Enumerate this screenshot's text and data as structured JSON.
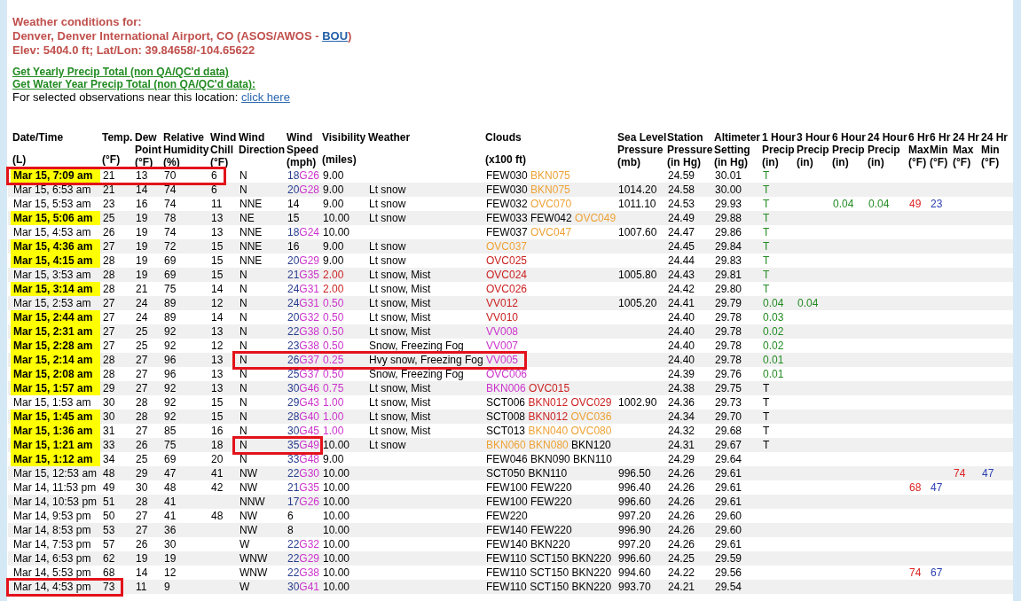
{
  "station": {
    "heading": "Weather conditions for:",
    "name": "Denver, Denver International Airport, CO (ASOS/AWOS -",
    "code": "BOU",
    "name_end": ")",
    "location": "Elev: 5404.0 ft; Lat/Lon: 39.84658/-104.65622"
  },
  "precip_links": [
    "Get Yearly Precip Total (non QA/QC'd data)",
    "Get Water Year Precip Total (non QA/QC'd data):"
  ],
  "nearby": {
    "text": "For selected observations near this location:",
    "link": "click here"
  },
  "columns": [
    {
      "kind": "time",
      "title": [
        "Date/Time"
      ],
      "unit": "(L)"
    },
    {
      "kind": "text",
      "title": [
        "Temp."
      ],
      "unit": "(°F)"
    },
    {
      "kind": "text",
      "title": [
        "Dew",
        "Point"
      ],
      "unit": "(°F)"
    },
    {
      "kind": "text",
      "title": [
        "Relative",
        "Humidity"
      ],
      "unit": "(%)"
    },
    {
      "kind": "text",
      "title": [
        "Wind",
        "Chill"
      ],
      "unit": "(°F)"
    },
    {
      "kind": "text",
      "title": [
        "Wind",
        "Direction"
      ]
    },
    {
      "kind": "gusts",
      "title": [
        "Wind",
        "Speed"
      ],
      "unit": "(mph)"
    },
    {
      "kind": "text",
      "title": [
        "Visibility"
      ],
      "unit": "(miles)"
    },
    {
      "kind": "text",
      "title": [
        "Weather"
      ]
    },
    {
      "kind": "layers",
      "title": [
        "Clouds"
      ],
      "unit": "(x100 ft)"
    },
    {
      "kind": "text",
      "title": [
        "Sea Level",
        "Pressure"
      ],
      "unit": "(mb)"
    },
    {
      "kind": "text",
      "title": [
        "Station",
        "Pressure"
      ],
      "unit": "(in Hg)"
    },
    {
      "kind": "text",
      "title": [
        "Altimeter",
        "Setting"
      ],
      "unit": "(in Hg)"
    },
    {
      "kind": "text",
      "title": [
        "1 Hour",
        "Precip"
      ],
      "unit": "(in)"
    },
    {
      "kind": "text",
      "title": [
        "3 Hour",
        "Precip"
      ],
      "unit": "(in)"
    },
    {
      "kind": "text",
      "title": [
        "6 Hour",
        "Precip"
      ],
      "unit": "(in)"
    },
    {
      "kind": "text",
      "title": [
        "24 Hour",
        "Precip"
      ],
      "unit": "(in)"
    },
    {
      "kind": "text",
      "title": [
        "6 Hr",
        "Max"
      ],
      "unit": "(°F)"
    },
    {
      "kind": "text",
      "title": [
        "6 Hr",
        "Min"
      ],
      "unit": "(°F)"
    },
    {
      "kind": "text",
      "title": [
        "24 Hr",
        "Max"
      ],
      "unit": "(°F)"
    },
    {
      "kind": "text",
      "title": [
        "24 Hr",
        "Min"
      ],
      "unit": "(°F)"
    }
  ],
  "rows": [
    {
      "time": "Mar 15, 7:09 am",
      "highlighted": true,
      "temp": "21",
      "dew_point": "13",
      "humidity": "70",
      "wind_chill": "6",
      "wind_direction": "N",
      "wind_speed": [
        {
          "text": "18",
          "color": "#283c8c"
        },
        {
          "text": "G26",
          "color": "#cc33cc"
        }
      ],
      "visibility": {
        "text": "9.00",
        "color": "#000000"
      },
      "clouds": [
        {
          "text": "FEW030",
          "color": "#000000"
        },
        {
          "text": "BKN075",
          "color": "#eea236"
        }
      ],
      "station_pressure": "24.59",
      "altimeter": "30.01",
      "precip_1h": {
        "text": "T",
        "color": "#228b22"
      },
      "outlined": {
        "time": true,
        "temp": true,
        "dew_point": true,
        "humidity": true,
        "wind_chill": true
      }
    },
    {
      "time": "Mar 15, 6:53 am",
      "highlighted": false,
      "temp": "21",
      "dew_point": "14",
      "humidity": "74",
      "wind_chill": "6",
      "wind_direction": "N",
      "wind_speed": [
        {
          "text": "20",
          "color": "#283c8c"
        },
        {
          "text": "G28",
          "color": "#cc33cc"
        }
      ],
      "visibility": {
        "text": "9.00",
        "color": "#000000"
      },
      "weather": "Lt snow",
      "clouds": [
        {
          "text": "FEW030",
          "color": "#000000"
        },
        {
          "text": "BKN075",
          "color": "#eea236"
        }
      ],
      "sea_level_pressure": "1014.20",
      "station_pressure": "24.58",
      "altimeter": "30.00",
      "precip_1h": {
        "text": "T",
        "color": "#228b22"
      }
    },
    {
      "time": "Mar 15, 5:53 am",
      "highlighted": false,
      "temp": "23",
      "dew_point": "16",
      "humidity": "74",
      "wind_chill": "11",
      "wind_direction": "NNE",
      "wind_speed": [
        {
          "text": "14",
          "color": "#000000"
        }
      ],
      "visibility": {
        "text": "9.00",
        "color": "#000000"
      },
      "weather": "Lt snow",
      "clouds": [
        {
          "text": "FEW032",
          "color": "#000000"
        },
        {
          "text": "OVC070",
          "color": "#eea236"
        }
      ],
      "sea_level_pressure": "1011.10",
      "station_pressure": "24.53",
      "altimeter": "29.93",
      "precip_1h": {
        "text": "T",
        "color": "#228b22"
      },
      "precip_6h": {
        "text": "0.04",
        "color": "#228b22"
      },
      "precip_24h": {
        "text": "0.04",
        "color": "#228b22"
      },
      "max_6h": {
        "text": "49",
        "color": "#dd2222"
      },
      "min_6h": {
        "text": "23",
        "color": "#2a3fb0"
      }
    },
    {
      "time": "Mar 15, 5:06 am",
      "highlighted": true,
      "temp": "25",
      "dew_point": "19",
      "humidity": "78",
      "wind_chill": "13",
      "wind_direction": "NE",
      "wind_speed": [
        {
          "text": "15",
          "color": "#000000"
        }
      ],
      "visibility": {
        "text": "10.00",
        "color": "#000000"
      },
      "weather": "Lt snow",
      "clouds": [
        {
          "text": "FEW033",
          "color": "#000000"
        },
        {
          "text": "FEW042",
          "color": "#000000"
        },
        {
          "text": "OVC049",
          "color": "#eea236"
        }
      ],
      "station_pressure": "24.49",
      "altimeter": "29.88",
      "precip_1h": {
        "text": "T",
        "color": "#228b22"
      }
    },
    {
      "time": "Mar 15, 4:53 am",
      "highlighted": false,
      "temp": "26",
      "dew_point": "19",
      "humidity": "74",
      "wind_chill": "13",
      "wind_direction": "NNE",
      "wind_speed": [
        {
          "text": "18",
          "color": "#283c8c"
        },
        {
          "text": "G24",
          "color": "#cc33cc"
        }
      ],
      "visibility": {
        "text": "10.00",
        "color": "#000000"
      },
      "clouds": [
        {
          "text": "FEW037",
          "color": "#000000"
        },
        {
          "text": "OVC047",
          "color": "#eea236"
        }
      ],
      "sea_level_pressure": "1007.60",
      "station_pressure": "24.47",
      "altimeter": "29.86",
      "precip_1h": {
        "text": "T",
        "color": "#228b22"
      }
    },
    {
      "time": "Mar 15, 4:36 am",
      "highlighted": true,
      "temp": "27",
      "dew_point": "19",
      "humidity": "72",
      "wind_chill": "15",
      "wind_direction": "NNE",
      "wind_speed": [
        {
          "text": "16",
          "color": "#000000"
        }
      ],
      "visibility": {
        "text": "9.00",
        "color": "#000000"
      },
      "weather": "Lt snow",
      "clouds": [
        {
          "text": "OVC037",
          "color": "#eea236"
        }
      ],
      "station_pressure": "24.45",
      "altimeter": "29.84",
      "precip_1h": {
        "text": "T",
        "color": "#228b22"
      }
    },
    {
      "time": "Mar 15, 4:15 am",
      "highlighted": true,
      "temp": "28",
      "dew_point": "19",
      "humidity": "69",
      "wind_chill": "15",
      "wind_direction": "NNE",
      "wind_speed": [
        {
          "text": "20",
          "color": "#283c8c"
        },
        {
          "text": "G29",
          "color": "#cc33cc"
        }
      ],
      "visibility": {
        "text": "9.00",
        "color": "#000000"
      },
      "weather": "Lt snow",
      "clouds": [
        {
          "text": "OVC025",
          "color": "#cc2222"
        }
      ],
      "station_pressure": "24.44",
      "altimeter": "29.83",
      "precip_1h": {
        "text": "T",
        "color": "#228b22"
      }
    },
    {
      "time": "Mar 15, 3:53 am",
      "highlighted": false,
      "temp": "28",
      "dew_point": "19",
      "humidity": "69",
      "wind_chill": "15",
      "wind_direction": "N",
      "wind_speed": [
        {
          "text": "21",
          "color": "#283c8c"
        },
        {
          "text": "G35",
          "color": "#cc33cc"
        }
      ],
      "visibility": {
        "text": "2.00",
        "color": "#cc2222"
      },
      "weather": "Lt snow, Mist",
      "clouds": [
        {
          "text": "OVC024",
          "color": "#cc2222"
        }
      ],
      "sea_level_pressure": "1005.80",
      "station_pressure": "24.43",
      "altimeter": "29.81",
      "precip_1h": {
        "text": "T",
        "color": "#228b22"
      }
    },
    {
      "time": "Mar 15, 3:14 am",
      "highlighted": true,
      "temp": "28",
      "dew_point": "21",
      "humidity": "75",
      "wind_chill": "14",
      "wind_direction": "N",
      "wind_speed": [
        {
          "text": "24",
          "color": "#283c8c"
        },
        {
          "text": "G31",
          "color": "#cc33cc"
        }
      ],
      "visibility": {
        "text": "2.00",
        "color": "#cc2222"
      },
      "weather": "Lt snow, Mist",
      "clouds": [
        {
          "text": "OVC026",
          "color": "#cc2222"
        }
      ],
      "station_pressure": "24.42",
      "altimeter": "29.80",
      "precip_1h": {
        "text": "T",
        "color": "#228b22"
      }
    },
    {
      "time": "Mar 15, 2:53 am",
      "highlighted": false,
      "temp": "27",
      "dew_point": "24",
      "humidity": "89",
      "wind_chill": "12",
      "wind_direction": "N",
      "wind_speed": [
        {
          "text": "24",
          "color": "#283c8c"
        },
        {
          "text": "G31",
          "color": "#cc33cc"
        }
      ],
      "visibility": {
        "text": "0.50",
        "color": "#cc33cc"
      },
      "weather": "Lt snow, Mist",
      "clouds": [
        {
          "text": "VV012",
          "color": "#cc2222"
        }
      ],
      "sea_level_pressure": "1005.20",
      "station_pressure": "24.41",
      "altimeter": "29.79",
      "precip_1h": {
        "text": "0.04",
        "color": "#228b22"
      },
      "precip_3h": {
        "text": "0.04",
        "color": "#228b22"
      }
    },
    {
      "time": "Mar 15, 2:44 am",
      "highlighted": true,
      "temp": "27",
      "dew_point": "24",
      "humidity": "89",
      "wind_chill": "14",
      "wind_direction": "N",
      "wind_speed": [
        {
          "text": "20",
          "color": "#283c8c"
        },
        {
          "text": "G32",
          "color": "#cc33cc"
        }
      ],
      "visibility": {
        "text": "0.50",
        "color": "#cc33cc"
      },
      "weather": "Lt snow, Mist",
      "clouds": [
        {
          "text": "VV010",
          "color": "#cc2222"
        }
      ],
      "station_pressure": "24.40",
      "altimeter": "29.78",
      "precip_1h": {
        "text": "0.03",
        "color": "#228b22"
      }
    },
    {
      "time": "Mar 15, 2:31 am",
      "highlighted": true,
      "temp": "27",
      "dew_point": "25",
      "humidity": "92",
      "wind_chill": "13",
      "wind_direction": "N",
      "wind_speed": [
        {
          "text": "22",
          "color": "#283c8c"
        },
        {
          "text": "G38",
          "color": "#cc33cc"
        }
      ],
      "visibility": {
        "text": "0.50",
        "color": "#cc33cc"
      },
      "weather": "Lt snow, Mist",
      "clouds": [
        {
          "text": "VV008",
          "color": "#cc33cc"
        }
      ],
      "station_pressure": "24.40",
      "altimeter": "29.78",
      "precip_1h": {
        "text": "0.02",
        "color": "#228b22"
      }
    },
    {
      "time": "Mar 15, 2:28 am",
      "highlighted": true,
      "temp": "27",
      "dew_point": "25",
      "humidity": "92",
      "wind_chill": "12",
      "wind_direction": "N",
      "wind_speed": [
        {
          "text": "23",
          "color": "#283c8c"
        },
        {
          "text": "G38",
          "color": "#cc33cc"
        }
      ],
      "visibility": {
        "text": "0.50",
        "color": "#cc33cc"
      },
      "weather": "Snow, Freezing Fog",
      "clouds": [
        {
          "text": "VV007",
          "color": "#cc33cc"
        }
      ],
      "station_pressure": "24.40",
      "altimeter": "29.78",
      "precip_1h": {
        "text": "0.02",
        "color": "#228b22"
      }
    },
    {
      "time": "Mar 15, 2:14 am",
      "highlighted": true,
      "temp": "28",
      "dew_point": "27",
      "humidity": "96",
      "wind_chill": "13",
      "wind_direction": "N",
      "wind_speed": [
        {
          "text": "26",
          "color": "#283c8c"
        },
        {
          "text": "G37",
          "color": "#cc33cc"
        }
      ],
      "visibility": {
        "text": "0.25",
        "color": "#cc33cc"
      },
      "weather": "Hvy snow, Freezing Fog",
      "clouds": [
        {
          "text": "VV005",
          "color": "#cc33cc"
        }
      ],
      "station_pressure": "24.40",
      "altimeter": "29.78",
      "precip_1h": {
        "text": "0.01",
        "color": "#228b22"
      },
      "outlined": {
        "wind_direction": true,
        "wind_speed": true,
        "visibility": true,
        "weather": true,
        "clouds": true
      }
    },
    {
      "time": "Mar 15, 2:08 am",
      "highlighted": true,
      "temp": "28",
      "dew_point": "27",
      "humidity": "96",
      "wind_chill": "13",
      "wind_direction": "N",
      "wind_speed": [
        {
          "text": "25",
          "color": "#283c8c"
        },
        {
          "text": "G37",
          "color": "#cc33cc"
        }
      ],
      "visibility": {
        "text": "0.50",
        "color": "#cc33cc"
      },
      "weather": "Snow, Freezing Fog",
      "clouds": [
        {
          "text": "OVC006",
          "color": "#cc33cc"
        }
      ],
      "station_pressure": "24.39",
      "altimeter": "29.76",
      "precip_1h": {
        "text": "0.01",
        "color": "#228b22"
      }
    },
    {
      "time": "Mar 15, 1:57 am",
      "highlighted": true,
      "temp": "29",
      "dew_point": "27",
      "humidity": "92",
      "wind_chill": "13",
      "wind_direction": "N",
      "wind_speed": [
        {
          "text": "30",
          "color": "#283c8c"
        },
        {
          "text": "G46",
          "color": "#cc33cc"
        }
      ],
      "visibility": {
        "text": "0.75",
        "color": "#cc33cc"
      },
      "weather": "Lt snow, Mist",
      "clouds": [
        {
          "text": "BKN006",
          "color": "#cc33cc"
        },
        {
          "text": "OVC015",
          "color": "#cc2222"
        }
      ],
      "station_pressure": "24.38",
      "altimeter": "29.75",
      "precip_1h": {
        "text": "T",
        "color": "#000000"
      }
    },
    {
      "time": "Mar 15, 1:53 am",
      "highlighted": false,
      "temp": "30",
      "dew_point": "28",
      "humidity": "92",
      "wind_chill": "15",
      "wind_direction": "N",
      "wind_speed": [
        {
          "text": "29",
          "color": "#283c8c"
        },
        {
          "text": "G43",
          "color": "#cc33cc"
        }
      ],
      "visibility": {
        "text": "1.00",
        "color": "#cc33cc"
      },
      "weather": "Lt snow, Mist",
      "clouds": [
        {
          "text": "SCT006",
          "color": "#000000"
        },
        {
          "text": "BKN012",
          "color": "#cc2222"
        },
        {
          "text": "OVC029",
          "color": "#cc2222"
        }
      ],
      "sea_level_pressure": "1002.90",
      "station_pressure": "24.36",
      "altimeter": "29.73",
      "precip_1h": {
        "text": "T",
        "color": "#000000"
      }
    },
    {
      "time": "Mar 15, 1:45 am",
      "highlighted": true,
      "temp": "30",
      "dew_point": "28",
      "humidity": "92",
      "wind_chill": "15",
      "wind_direction": "N",
      "wind_speed": [
        {
          "text": "28",
          "color": "#283c8c"
        },
        {
          "text": "G40",
          "color": "#cc33cc"
        }
      ],
      "visibility": {
        "text": "1.00",
        "color": "#cc33cc"
      },
      "weather": "Lt snow, Mist",
      "clouds": [
        {
          "text": "SCT008",
          "color": "#000000"
        },
        {
          "text": "BKN012",
          "color": "#cc2222"
        },
        {
          "text": "OVC036",
          "color": "#eea236"
        }
      ],
      "station_pressure": "24.34",
      "altimeter": "29.70",
      "precip_1h": {
        "text": "T",
        "color": "#000000"
      }
    },
    {
      "time": "Mar 15, 1:36 am",
      "highlighted": true,
      "temp": "31",
      "dew_point": "27",
      "humidity": "85",
      "wind_chill": "16",
      "wind_direction": "N",
      "wind_speed": [
        {
          "text": "30",
          "color": "#283c8c"
        },
        {
          "text": "G45",
          "color": "#cc33cc"
        }
      ],
      "visibility": {
        "text": "1.00",
        "color": "#cc33cc"
      },
      "weather": "Lt snow, Mist",
      "clouds": [
        {
          "text": "SCT013",
          "color": "#000000"
        },
        {
          "text": "BKN040",
          "color": "#eea236"
        },
        {
          "text": "OVC080",
          "color": "#eea236"
        }
      ],
      "station_pressure": "24.32",
      "altimeter": "29.68",
      "precip_1h": {
        "text": "T",
        "color": "#000000"
      }
    },
    {
      "time": "Mar 15, 1:21 am",
      "highlighted": true,
      "temp": "33",
      "dew_point": "26",
      "humidity": "75",
      "wind_chill": "18",
      "wind_direction": "N",
      "wind_speed": [
        {
          "text": "35",
          "color": "#283c8c"
        },
        {
          "text": "G49",
          "color": "#cc33cc"
        }
      ],
      "visibility": {
        "text": "10.00",
        "color": "#000000"
      },
      "weather": "Lt snow",
      "clouds": [
        {
          "text": "BKN060",
          "color": "#eea236"
        },
        {
          "text": "BKN080",
          "color": "#eea236"
        },
        {
          "text": "BKN120",
          "color": "#000000"
        }
      ],
      "station_pressure": "24.31",
      "altimeter": "29.67",
      "precip_1h": {
        "text": "T",
        "color": "#000000"
      },
      "outlined": {
        "wind_direction": true,
        "wind_speed": true
      }
    },
    {
      "time": "Mar 15, 1:12 am",
      "highlighted": true,
      "temp": "34",
      "dew_point": "25",
      "humidity": "69",
      "wind_chill": "20",
      "wind_direction": "N",
      "wind_speed": [
        {
          "text": "33",
          "color": "#283c8c"
        },
        {
          "text": "G48",
          "color": "#cc33cc"
        }
      ],
      "visibility": {
        "text": "9.00",
        "color": "#000000"
      },
      "clouds": [
        {
          "text": "FEW046",
          "color": "#000000"
        },
        {
          "text": "BKN090",
          "color": "#000000"
        },
        {
          "text": "BKN110",
          "color": "#000000"
        }
      ],
      "station_pressure": "24.29",
      "altimeter": "29.64"
    },
    {
      "time": "Mar 15, 12:53 am",
      "highlighted": false,
      "temp": "48",
      "dew_point": "29",
      "humidity": "47",
      "wind_chill": "41",
      "wind_direction": "NW",
      "wind_speed": [
        {
          "text": "22",
          "color": "#283c8c"
        },
        {
          "text": "G30",
          "color": "#cc33cc"
        }
      ],
      "visibility": {
        "text": "10.00",
        "color": "#000000"
      },
      "clouds": [
        {
          "text": "SCT050",
          "color": "#000000"
        },
        {
          "text": "BKN110",
          "color": "#000000"
        }
      ],
      "sea_level_pressure": "996.50",
      "station_pressure": "24.26",
      "altimeter": "29.61",
      "max_24h": {
        "text": "74",
        "color": "#dd2222"
      },
      "min_24h": {
        "text": "47",
        "color": "#2a3fb0"
      }
    },
    {
      "time": "Mar 14, 11:53 pm",
      "highlighted": false,
      "temp": "49",
      "dew_point": "30",
      "humidity": "48",
      "wind_chill": "42",
      "wind_direction": "NW",
      "wind_speed": [
        {
          "text": "21",
          "color": "#283c8c"
        },
        {
          "text": "G35",
          "color": "#cc33cc"
        }
      ],
      "visibility": {
        "text": "10.00",
        "color": "#000000"
      },
      "clouds": [
        {
          "text": "FEW100",
          "color": "#000000"
        },
        {
          "text": "FEW220",
          "color": "#000000"
        }
      ],
      "sea_level_pressure": "996.40",
      "station_pressure": "24.26",
      "altimeter": "29.61",
      "max_6h": {
        "text": "68",
        "color": "#dd2222"
      },
      "min_6h": {
        "text": "47",
        "color": "#2a3fb0"
      }
    },
    {
      "time": "Mar 14, 10:53 pm",
      "highlighted": false,
      "temp": "51",
      "dew_point": "28",
      "humidity": "41",
      "wind_direction": "NNW",
      "wind_speed": [
        {
          "text": "17",
          "color": "#283c8c"
        },
        {
          "text": "G26",
          "color": "#cc33cc"
        }
      ],
      "visibility": {
        "text": "10.00",
        "color": "#000000"
      },
      "clouds": [
        {
          "text": "FEW100",
          "color": "#000000"
        },
        {
          "text": "FEW220",
          "color": "#000000"
        }
      ],
      "sea_level_pressure": "996.60",
      "station_pressure": "24.26",
      "altimeter": "29.61"
    },
    {
      "time": "Mar 14, 9:53 pm",
      "highlighted": false,
      "temp": "50",
      "dew_point": "27",
      "humidity": "41",
      "wind_chill": "48",
      "wind_direction": "NW",
      "wind_speed": [
        {
          "text": "6",
          "color": "#000000"
        }
      ],
      "visibility": {
        "text": "10.00",
        "color": "#000000"
      },
      "clouds": [
        {
          "text": "FEW220",
          "color": "#000000"
        }
      ],
      "sea_level_pressure": "997.20",
      "station_pressure": "24.26",
      "altimeter": "29.60"
    },
    {
      "time": "Mar 14, 8:53 pm",
      "highlighted": false,
      "temp": "53",
      "dew_point": "27",
      "humidity": "36",
      "wind_direction": "NW",
      "wind_speed": [
        {
          "text": "8",
          "color": "#000000"
        }
      ],
      "visibility": {
        "text": "10.00",
        "color": "#000000"
      },
      "clouds": [
        {
          "text": "FEW140",
          "color": "#000000"
        },
        {
          "text": "FEW220",
          "color": "#000000"
        }
      ],
      "sea_level_pressure": "996.90",
      "station_pressure": "24.26",
      "altimeter": "29.60"
    },
    {
      "time": "Mar 14, 7:53 pm",
      "highlighted": false,
      "temp": "57",
      "dew_point": "26",
      "humidity": "30",
      "wind_direction": "W",
      "wind_speed": [
        {
          "text": "22",
          "color": "#283c8c"
        },
        {
          "text": "G32",
          "color": "#cc33cc"
        }
      ],
      "visibility": {
        "text": "10.00",
        "color": "#000000"
      },
      "clouds": [
        {
          "text": "FEW140",
          "color": "#000000"
        },
        {
          "text": "BKN220",
          "color": "#000000"
        }
      ],
      "sea_level_pressure": "997.20",
      "station_pressure": "24.26",
      "altimeter": "29.61"
    },
    {
      "time": "Mar 14, 6:53 pm",
      "highlighted": false,
      "temp": "62",
      "dew_point": "19",
      "humidity": "19",
      "wind_direction": "WNW",
      "wind_speed": [
        {
          "text": "22",
          "color": "#283c8c"
        },
        {
          "text": "G29",
          "color": "#cc33cc"
        }
      ],
      "visibility": {
        "text": "10.00",
        "color": "#000000"
      },
      "clouds": [
        {
          "text": "FEW110",
          "color": "#000000"
        },
        {
          "text": "SCT150",
          "color": "#000000"
        },
        {
          "text": "BKN220",
          "color": "#000000"
        }
      ],
      "sea_level_pressure": "996.60",
      "station_pressure": "24.25",
      "altimeter": "29.59"
    },
    {
      "time": "Mar 14, 5:53 pm",
      "highlighted": false,
      "temp": "68",
      "dew_point": "14",
      "humidity": "12",
      "wind_direction": "WNW",
      "wind_speed": [
        {
          "text": "22",
          "color": "#283c8c"
        },
        {
          "text": "G38",
          "color": "#cc33cc"
        }
      ],
      "visibility": {
        "text": "10.00",
        "color": "#000000"
      },
      "clouds": [
        {
          "text": "FEW110",
          "color": "#000000"
        },
        {
          "text": "SCT150",
          "color": "#000000"
        },
        {
          "text": "BKN220",
          "color": "#000000"
        }
      ],
      "sea_level_pressure": "994.60",
      "station_pressure": "24.22",
      "altimeter": "29.56",
      "max_6h": {
        "text": "74",
        "color": "#dd2222"
      },
      "min_6h": {
        "text": "67",
        "color": "#2a3fb0"
      }
    },
    {
      "time": "Mar 14, 4:53 pm",
      "highlighted": false,
      "temp": "73",
      "dew_point": "11",
      "humidity": "9",
      "wind_direction": "W",
      "wind_speed": [
        {
          "text": "30",
          "color": "#283c8c"
        },
        {
          "text": "G41",
          "color": "#cc33cc"
        }
      ],
      "visibility": {
        "text": "10.00",
        "color": "#000000"
      },
      "clouds": [
        {
          "text": "FEW110",
          "color": "#000000"
        },
        {
          "text": "SCT150",
          "color": "#000000"
        },
        {
          "text": "BKN220",
          "color": "#000000"
        }
      ],
      "sea_level_pressure": "993.70",
      "station_pressure": "24.21",
      "altimeter": "29.54",
      "outlined": {
        "time": true,
        "temp": true
      }
    }
  ]
}
